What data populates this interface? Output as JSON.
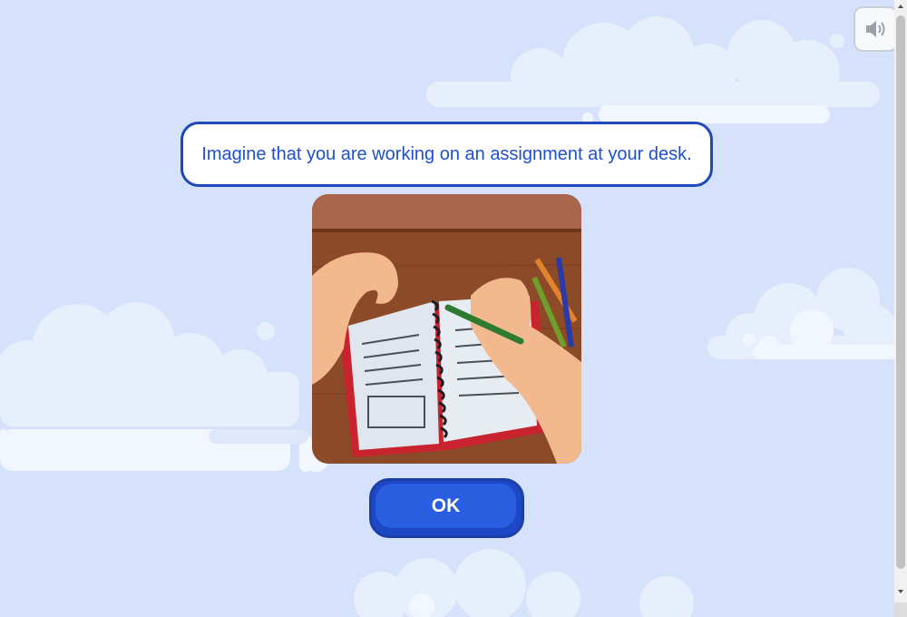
{
  "prompt": {
    "text": "Imagine that you are working on an assignment at your desk."
  },
  "ok_button": {
    "label": "OK"
  },
  "illustration": {
    "alt": "Imagine that you are working on an assignment at your desk."
  },
  "icons": {
    "sound": "speaker-volume-icon"
  },
  "colors": {
    "background": "#d6e2fb",
    "prompt_border": "#1f48b8",
    "prompt_text": "#1e4fcf",
    "button": "#2a5ee0"
  }
}
